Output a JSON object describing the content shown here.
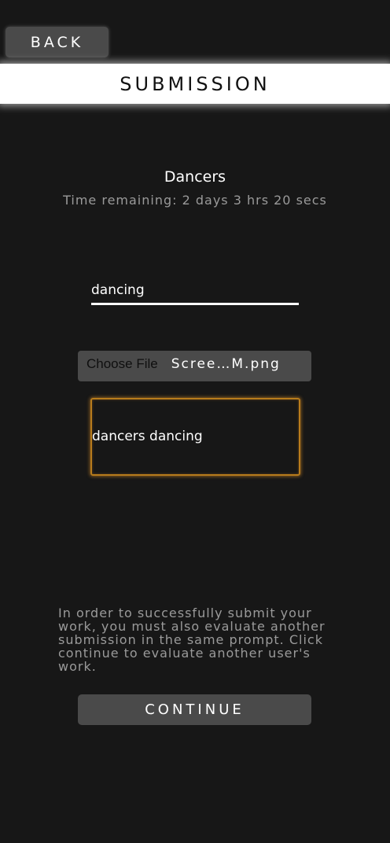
{
  "header": {
    "back_label": "BACK",
    "title": "SUBMISSION"
  },
  "prompt": {
    "name": "Dancers",
    "time_remaining": "Time remaining: 2 days 3 hrs 20 secs"
  },
  "form": {
    "title_value": "dancing",
    "choose_file_label": "Choose File",
    "file_name": "Scree…M.png",
    "description_value": "dancers dancing",
    "focus_color": "#b87c1c"
  },
  "info": {
    "text": "In order to successfully submit your work, you must also evaluate another submission in the same prompt. Click continue to evaluate another user's work."
  },
  "actions": {
    "continue_label": "CONTINUE"
  }
}
